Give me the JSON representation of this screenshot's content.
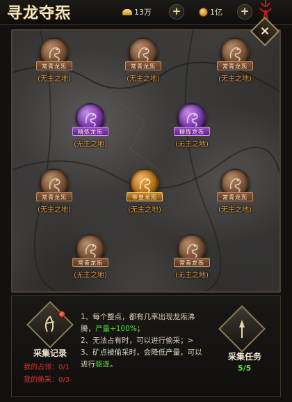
{
  "header": {
    "title": "寻龙夺炁",
    "ingot_amount": "13万",
    "coin_amount": "1亿",
    "plus_label": "+",
    "close_label": "×"
  },
  "nodes": [
    {
      "name": "常青龙炁",
      "owner": "(无主之地)",
      "tier": "bronze"
    },
    {
      "name": "常青龙炁",
      "owner": "(无主之地)",
      "tier": "bronze"
    },
    {
      "name": "常青龙炁",
      "owner": "(无主之地)",
      "tier": "bronze"
    },
    {
      "name": "精炼龙炁",
      "owner": "(无主之地)",
      "tier": "purple"
    },
    {
      "name": "精炼龙炁",
      "owner": "(无主之地)",
      "tier": "purple"
    },
    {
      "name": "常青龙炁",
      "owner": "(无主之地)",
      "tier": "bronze"
    },
    {
      "name": "帝皇龙炁",
      "owner": "(无主之地)",
      "tier": "gold"
    },
    {
      "name": "常青龙炁",
      "owner": "(无主之地)",
      "tier": "bronze"
    },
    {
      "name": "常青龙炁",
      "owner": "(无主之地)",
      "tier": "bronze"
    },
    {
      "name": "常青龙炁",
      "owner": "(无主之地)",
      "tier": "bronze"
    }
  ],
  "panel": {
    "record_label": "采集记录",
    "my_occupy": "我的占领：0/1",
    "my_steal": "我的偷采：0/3",
    "rule1_a": "1、每个整点，都有几率出现龙炁沸腾，",
    "rule1_b": "产量+100%",
    "rule1_c": "；",
    "rule2": "2、无法占有时，可以进行偷采；>",
    "rule3_a": "3、矿点被偷采时，会降低产量，可以进行",
    "rule3_b": "驱逐",
    "rule3_c": "。",
    "task_label": "采集任务",
    "task_count": "5/5"
  },
  "colors": {
    "owner_text": "#e99a3e",
    "highlight_green": "#4fdc3c",
    "warning_red": "#e0322a"
  }
}
